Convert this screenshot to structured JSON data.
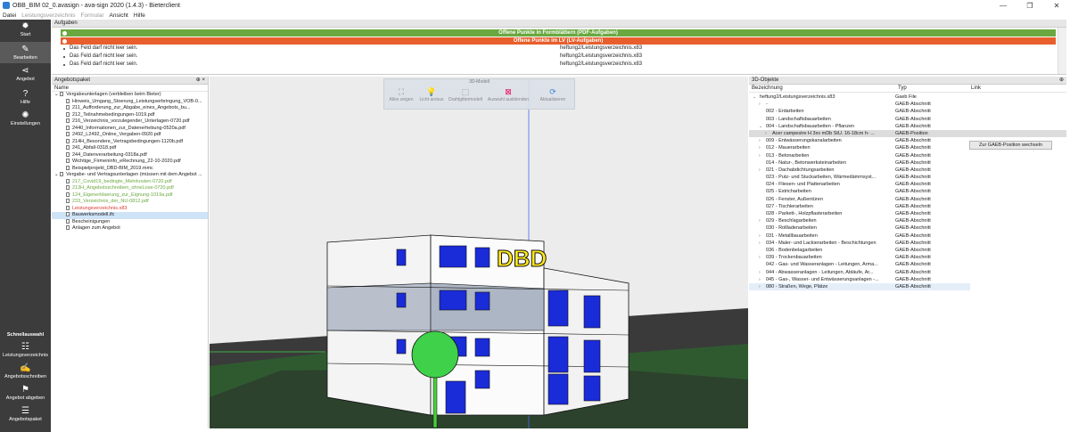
{
  "window": {
    "title": "OBB_BIM 02_0.avasign - ava-sign 2020 (1.4.3) - Bieterclient",
    "controls": [
      "—",
      "❐",
      "✕"
    ]
  },
  "menu": [
    {
      "label": "Datei",
      "dim": false
    },
    {
      "label": "Leistungsverzeichnis",
      "dim": true
    },
    {
      "label": "Formular",
      "dim": true
    },
    {
      "label": "Ansicht",
      "dim": false
    },
    {
      "label": "Hilfe",
      "dim": false
    }
  ],
  "sidebar": {
    "top": [
      {
        "label": "Start",
        "icon": "gear-icon"
      },
      {
        "label": "Bearbeiten",
        "icon": "pencil-icon",
        "active": true
      },
      {
        "label": "Angebot",
        "icon": "share-icon"
      },
      {
        "label": "Hilfe",
        "icon": "help-icon"
      },
      {
        "label": "Einstellungen",
        "icon": "settings-icon"
      }
    ],
    "schnell_title": "Schnellauswahl",
    "bottom": [
      {
        "label": "Leistungsverzeichnis",
        "icon": "list-icon"
      },
      {
        "label": "Angebotsschreiben",
        "icon": "edit-doc-icon"
      },
      {
        "label": "Angebot abgeben",
        "icon": "submit-icon"
      },
      {
        "label": "Angebotspaket",
        "icon": "package-icon"
      }
    ]
  },
  "aufgaben": {
    "title": "Aufgaben",
    "green_bar": "Offene Punkte in Formblättern (PDF-Aufgaben)",
    "red_bar": "Offene Punkte im LV (LV-Aufgaben)",
    "rows": [
      {
        "msg": "Das Feld darf nicht leer sein.",
        "ref": "heftung2/Leistungsverzeichnis.x83"
      },
      {
        "msg": "Das Feld darf nicht leer sein.",
        "ref": "heftung2/Leistungsverzeichnis.x83"
      },
      {
        "msg": "Das Feld darf nicht leer sein.",
        "ref": "heftung2/Leistungsverzeichnis.x83"
      }
    ]
  },
  "angebotspaket": {
    "title": "Angebotspaket",
    "col_name": "Name",
    "items": [
      {
        "text": "Vergabeunterlagen (verbleiben beim Bieter)",
        "level": 0,
        "kind": "folder",
        "color": ""
      },
      {
        "text": "Hinweis_Umgang_Stoerung_Leistungserbringung_VOB-0...",
        "level": 2,
        "kind": "file",
        "color": ""
      },
      {
        "text": "211_Aufforderung_zur_Abgabe_eines_Angebots_bu...",
        "level": 2,
        "kind": "file",
        "color": ""
      },
      {
        "text": "212_Teilnahmebedingungen-1019.pdf",
        "level": 2,
        "kind": "file",
        "color": ""
      },
      {
        "text": "216_Verzeichnis_vorzulegender_Unterlagen-0720.pdf",
        "level": 2,
        "kind": "file",
        "color": ""
      },
      {
        "text": "2440_Informationen_zur_Datenerhebung-0520a.pdf",
        "level": 2,
        "kind": "file",
        "color": ""
      },
      {
        "text": "2492_L2492_Online_Vergaben-0920.pdf",
        "level": 2,
        "kind": "file",
        "color": ""
      },
      {
        "text": "214H_Besondere_Vertragsbedingungen-1120b.pdf",
        "level": 2,
        "kind": "file",
        "color": ""
      },
      {
        "text": "241_Abfall-0318.pdf",
        "level": 2,
        "kind": "file",
        "color": ""
      },
      {
        "text": "244_Datenverarbeitung-0318a.pdf",
        "level": 2,
        "kind": "file",
        "color": ""
      },
      {
        "text": "Wichtige_Firmeninfo_eRechnung_22-10-2020.pdf",
        "level": 2,
        "kind": "file",
        "color": ""
      },
      {
        "text": "Beispielprojekt_DBD-BIM_2019.mmc",
        "level": 2,
        "kind": "file",
        "color": ""
      },
      {
        "text": "Vergabe- und Vertragsunterlagen (müssen mit dem Angebot ...",
        "level": 0,
        "kind": "folder",
        "color": ""
      },
      {
        "text": "217_Covid19_bedingte_Mehrkosten-0720.pdf",
        "level": 2,
        "kind": "file",
        "color": "green"
      },
      {
        "text": "213H_Angebotsschreiben_ohneLose-0720.pdf",
        "level": 2,
        "kind": "file",
        "color": "green"
      },
      {
        "text": "124_Eigenerklaerung_zur_Eignung-1019a.pdf",
        "level": 2,
        "kind": "file",
        "color": "green"
      },
      {
        "text": "233_Verzeichnis_der_NU-0812.pdf",
        "level": 2,
        "kind": "file",
        "color": "green"
      },
      {
        "text": "Leistungsverzeichnis.x83",
        "level": 2,
        "kind": "file",
        "color": "red"
      },
      {
        "text": "Bauwerksmodell.ifc",
        "level": 2,
        "kind": "file",
        "color": "",
        "selected": true
      },
      {
        "text": "Bescheinigungen",
        "level": 2,
        "kind": "file",
        "color": ""
      },
      {
        "text": "Anlagen zum Angebot",
        "level": 2,
        "kind": "file",
        "color": ""
      }
    ]
  },
  "viewer": {
    "toolbar_title": "3D-Modell",
    "buttons": [
      "Alles zeigen",
      "Licht an/aus",
      "Drahtgittermodell",
      "Auswahl ausblenden",
      "Aktualisieren"
    ],
    "sign_text": "DBD"
  },
  "objects": {
    "title": "3D-Objekte",
    "cols": {
      "name": "Bezeichnung",
      "type": "Typ",
      "link": "Link"
    },
    "switch_button": "Zur GAEB-Position wechseln",
    "rows": [
      {
        "name": "heftung2/Leistungsverzeichnis.x83",
        "type": "Gaeb File",
        "indent": 0,
        "chev": "v"
      },
      {
        "name": "-",
        "type": "GAEB-Abschnitt",
        "indent": 1,
        "chev": ">"
      },
      {
        "name": "002 - Erdarbeiten",
        "type": "GAEB-Abschnitt",
        "indent": 1,
        "chev": ""
      },
      {
        "name": "003 - Landschaftsbauarbeiten",
        "type": "GAEB-Abschnitt",
        "indent": 1,
        "chev": ""
      },
      {
        "name": "004 - Landschaftsbauarbeiten - Pflanzen",
        "type": "GAEB-Abschnitt",
        "indent": 1,
        "chev": "v"
      },
      {
        "name": "Acer campestre H 3xv mDb StU. 16-18cm h- ...",
        "type": "GAEB-Position",
        "indent": 2,
        "chev": ">",
        "sel": true
      },
      {
        "name": "009 - Entwässerungskanalarbeiten",
        "type": "GAEB-Abschnitt",
        "indent": 1,
        "chev": ">"
      },
      {
        "name": "012 - Mauerarbeiten",
        "type": "GAEB-Abschnitt",
        "indent": 1,
        "chev": ">"
      },
      {
        "name": "013 - Betonarbeiten",
        "type": "GAEB-Abschnitt",
        "indent": 1,
        "chev": ">"
      },
      {
        "name": "014 - Natur-, Betonwerksteinarbeiten",
        "type": "GAEB-Abschnitt",
        "indent": 1,
        "chev": ""
      },
      {
        "name": "021 - Dachabdichtungsarbeiten",
        "type": "GAEB-Abschnitt",
        "indent": 1,
        "chev": ">"
      },
      {
        "name": "023 - Putz- und Stuckarbeiten, Wärmedämmsyst...",
        "type": "GAEB-Abschnitt",
        "indent": 1,
        "chev": ""
      },
      {
        "name": "024 - Fliesen- und Plattenarbeiten",
        "type": "GAEB-Abschnitt",
        "indent": 1,
        "chev": ""
      },
      {
        "name": "025 - Estricharbeiten",
        "type": "GAEB-Abschnitt",
        "indent": 1,
        "chev": ""
      },
      {
        "name": "026 - Fenster, Außentüren",
        "type": "GAEB-Abschnitt",
        "indent": 1,
        "chev": ""
      },
      {
        "name": "027 - Tischlerarbeiten",
        "type": "GAEB-Abschnitt",
        "indent": 1,
        "chev": ""
      },
      {
        "name": "028 - Parkett-, Holzpflasterarbeiten",
        "type": "GAEB-Abschnitt",
        "indent": 1,
        "chev": ""
      },
      {
        "name": "029 - Beschlagarbeiten",
        "type": "GAEB-Abschnitt",
        "indent": 1,
        "chev": ">"
      },
      {
        "name": "030 - Rollladenarbeiten",
        "type": "GAEB-Abschnitt",
        "indent": 1,
        "chev": ""
      },
      {
        "name": "031 - Metallbauarbeiten",
        "type": "GAEB-Abschnitt",
        "indent": 1,
        "chev": ">"
      },
      {
        "name": "034 - Maler- und Lackierarbeiten - Beschichtungen",
        "type": "GAEB-Abschnitt",
        "indent": 1,
        "chev": ">"
      },
      {
        "name": "036 - Bodenbelagarbeiten",
        "type": "GAEB-Abschnitt",
        "indent": 1,
        "chev": ""
      },
      {
        "name": "039 - Trockenbauarbeiten",
        "type": "GAEB-Abschnitt",
        "indent": 1,
        "chev": ">"
      },
      {
        "name": "042 - Gas- und Wasseranlagen - Leitungen, Arma...",
        "type": "GAEB-Abschnitt",
        "indent": 1,
        "chev": ""
      },
      {
        "name": "044 - Abwasseranlagen - Leitungen, Abläufe, Ar...",
        "type": "GAEB-Abschnitt",
        "indent": 1,
        "chev": ">"
      },
      {
        "name": "045 - Gas-, Wasser- und Entwässerungsanlagen -...",
        "type": "GAEB-Abschnitt",
        "indent": 1,
        "chev": ">"
      },
      {
        "name": "080 - Straßen, Wege, Plätze",
        "type": "GAEB-Abschnitt",
        "indent": 1,
        "chev": ">",
        "hover": true
      }
    ]
  }
}
